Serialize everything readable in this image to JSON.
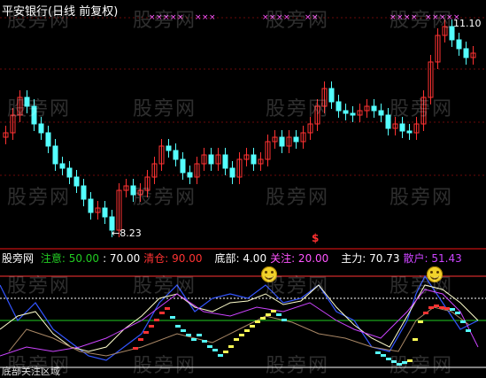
{
  "header": {
    "title": "平安银行(日线 前复权)"
  },
  "price_labels": {
    "high": "11.10",
    "low": "8.23"
  },
  "indicator": {
    "name": "股旁网",
    "items": [
      {
        "label": "注意: ",
        "value": "50.00",
        "color": "#22cc22"
      },
      {
        "label": ": ",
        "value": "70.00",
        "color": "#ffffff"
      },
      {
        "label": "清仓: ",
        "value": "90.00",
        "color": "#ff3333"
      },
      {
        "label": "底部: ",
        "value": "4.00",
        "color": "#ffffff"
      },
      {
        "label": "关注: ",
        "value": "20.00",
        "color": "#ff55ff"
      },
      {
        "label": "主力: ",
        "value": "70.73",
        "color": "#ffffff"
      },
      {
        "label": "散户: ",
        "value": "51.43",
        "color": "#cc44ff"
      }
    ],
    "bottom_label": "底部关注区域"
  },
  "watermark": "股旁网",
  "colors": {
    "up": "#ff3232",
    "down": "#54ffff",
    "bg": "#000000",
    "grid": "#7a0a0a"
  }
}
